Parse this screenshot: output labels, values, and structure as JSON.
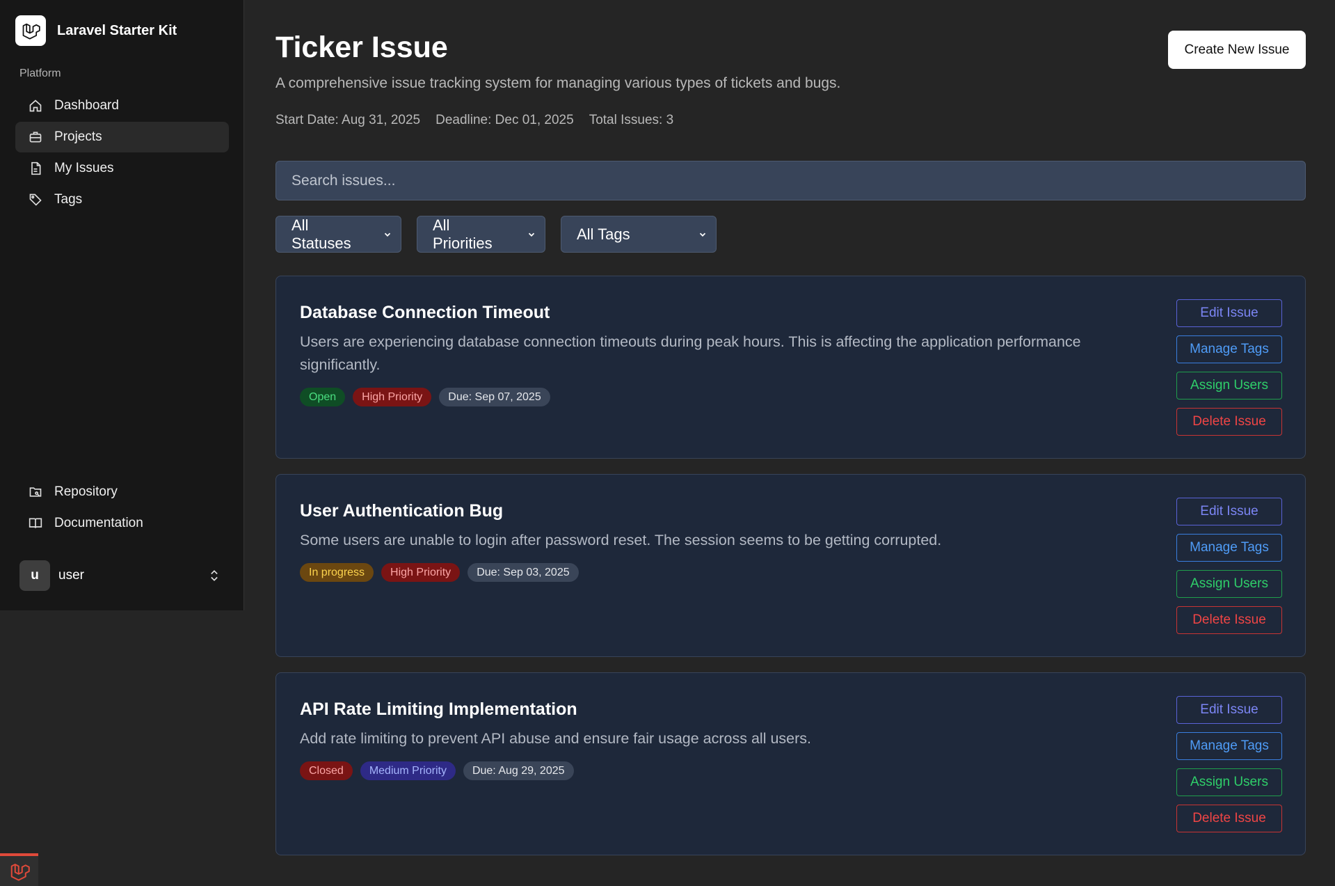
{
  "sidebar": {
    "brand": "Laravel Starter Kit",
    "group_label": "Platform",
    "nav": [
      {
        "label": "Dashboard",
        "icon": "home-icon"
      },
      {
        "label": "Projects",
        "icon": "briefcase-icon",
        "active": true
      },
      {
        "label": "My Issues",
        "icon": "file-icon"
      },
      {
        "label": "Tags",
        "icon": "tag-icon"
      }
    ],
    "footer_nav": [
      {
        "label": "Repository",
        "icon": "folder-git-icon"
      },
      {
        "label": "Documentation",
        "icon": "book-icon"
      }
    ],
    "user": {
      "initial": "u",
      "name": "user"
    }
  },
  "header": {
    "title": "Ticker Issue",
    "description": "A comprehensive issue tracking system for managing various types of tickets and bugs.",
    "start_date": "Start Date: Aug 31, 2025",
    "deadline": "Deadline: Dec 01, 2025",
    "total": "Total Issues: 3",
    "create_label": "Create New Issue"
  },
  "search": {
    "placeholder": "Search issues..."
  },
  "filters": {
    "status": "All Statuses",
    "priority": "All Priorities",
    "tags": "All Tags"
  },
  "actions": {
    "edit": "Edit Issue",
    "tags": "Manage Tags",
    "assign": "Assign Users",
    "delete": "Delete Issue"
  },
  "issues": [
    {
      "title": "Database Connection Timeout",
      "description": "Users are experiencing database connection timeouts during peak hours. This is affecting the application performance significantly.",
      "status": "Open",
      "priority": "High Priority",
      "due": "Due: Sep 07, 2025"
    },
    {
      "title": "User Authentication Bug",
      "description": "Some users are unable to login after password reset. The session seems to be getting corrupted.",
      "status": "In progress",
      "priority": "High Priority",
      "due": "Due: Sep 03, 2025"
    },
    {
      "title": "API Rate Limiting Implementation",
      "description": "Add rate limiting to prevent API abuse and ensure fair usage across all users.",
      "status": "Closed",
      "priority": "Medium Priority",
      "due": "Due: Aug 29, 2025"
    }
  ],
  "colors": {
    "open_bg": "#0f4d25",
    "open_fg": "#4ade80",
    "progress_bg": "#6b4710",
    "progress_fg": "#fcd34d",
    "closed_bg": "#7a1414",
    "closed_fg": "#fca5a5",
    "high_bg": "#7a1414",
    "high_fg": "#fca5a5",
    "medium_bg": "#2e2a86",
    "medium_fg": "#a5b4fc",
    "due_bg": "#3a4558",
    "due_fg": "#e5e7eb"
  }
}
